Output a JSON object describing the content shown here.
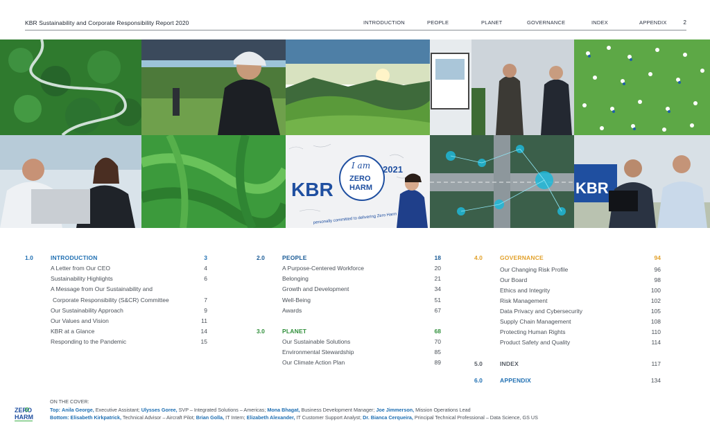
{
  "header": {
    "report_title": "KBR Sustainability and Corporate Responsibility Report 2020",
    "nav": [
      "INTRODUCTION",
      "PEOPLE",
      "PLANET",
      "GOVERNANCE",
      "INDEX",
      "APPENDIX"
    ],
    "page_number": "2"
  },
  "photos": {
    "sign_kbr_1": "KBR",
    "sign_iam": "I am",
    "sign_zero": "ZERO",
    "sign_harm": "HARM",
    "sign_year": "2021",
    "sign_committed": "personally committed to delivering Zero Harm",
    "sign_kbr_2": "KBR"
  },
  "toc": {
    "sections": [
      {
        "number": "1.0",
        "title": "INTRODUCTION",
        "page": "3",
        "items": [
          {
            "title": "A Letter from Our CEO",
            "page": "4"
          },
          {
            "title": "Sustainability Highlights",
            "page": "6"
          },
          {
            "title": "A Message from Our Sustainability and",
            "page": ""
          },
          {
            "title": "Corporate Responsibility (S&CR) Committee",
            "page": "7"
          },
          {
            "title": "Our Sustainability Approach",
            "page": "9"
          },
          {
            "title": "Our Values and Vision",
            "page": "11"
          },
          {
            "title": "KBR at a Glance",
            "page": "14"
          },
          {
            "title": "Responding to the Pandemic",
            "page": "15"
          }
        ]
      },
      {
        "number": "2.0",
        "title": "PEOPLE",
        "page": "18",
        "items": [
          {
            "title": "A Purpose-Centered Workforce",
            "page": "20"
          },
          {
            "title": "Belonging",
            "page": "21"
          },
          {
            "title": "Growth and Development",
            "page": "34"
          },
          {
            "title": "Well-Being",
            "page": "51"
          },
          {
            "title": "Awards",
            "page": "67"
          }
        ]
      },
      {
        "number": "3.0",
        "title": "PLANET",
        "page": "68",
        "items": [
          {
            "title": "Our Sustainable Solutions",
            "page": "70"
          },
          {
            "title": "Environmental Stewardship",
            "page": "85"
          },
          {
            "title": "Our Climate Action Plan",
            "page": "89"
          }
        ]
      },
      {
        "number": "4.0",
        "title": "GOVERNANCE",
        "page": "94",
        "items": [
          {
            "title": "Our Changing Risk Profile",
            "page": "96"
          },
          {
            "title": "Our Board",
            "page": "98"
          },
          {
            "title": "Ethics and Integrity",
            "page": "100"
          },
          {
            "title": "Risk Management",
            "page": "102"
          },
          {
            "title": "Data Privacy and Cybersecurity",
            "page": "105"
          },
          {
            "title": "Supply Chain Management",
            "page": "108"
          },
          {
            "title": "Protecting Human Rights",
            "page": "110"
          },
          {
            "title": "Product Safety and Quality",
            "page": "114"
          }
        ]
      },
      {
        "number": "5.0",
        "title": "INDEX",
        "page": "117",
        "items": []
      },
      {
        "number": "6.0",
        "title": "APPENDIX",
        "page": "134",
        "items": []
      }
    ]
  },
  "cover": {
    "label": "ON THE COVER:",
    "top_prefix": "Top:",
    "top": [
      {
        "name": "Anila George,",
        "role": "Executive Assistant;"
      },
      {
        "name": "Ulysses Goree,",
        "role": "SVP – Integrated Solutions – Americas;"
      },
      {
        "name": "Mona Bhagat,",
        "role": "Business Development Manager;"
      },
      {
        "name": "Joe Jimmerson,",
        "role": "Mission Operations Lead"
      }
    ],
    "bottom_prefix": "Bottom:",
    "bottom": [
      {
        "name": "Elisabeth Kirkpatrick,",
        "role": "Technical Advisor – Aircraft Pilot;"
      },
      {
        "name": "Brian Golla,",
        "role": "IT Intern;"
      },
      {
        "name": "Elizabeth Alexander,",
        "role": "IT Customer Support Analyst;"
      },
      {
        "name": "Dr. Bianca Cerqueira,",
        "role": "Principal Technical Professional – Data Science, GS US"
      }
    ]
  },
  "logo": {
    "line1": "ZERO",
    "line2": "HARM"
  },
  "colors": {
    "intro": "#1f6fb2",
    "people": "#1a5b96",
    "planet": "#2f8f3a",
    "governance": "#e2a12b",
    "grey": "#555b63"
  }
}
